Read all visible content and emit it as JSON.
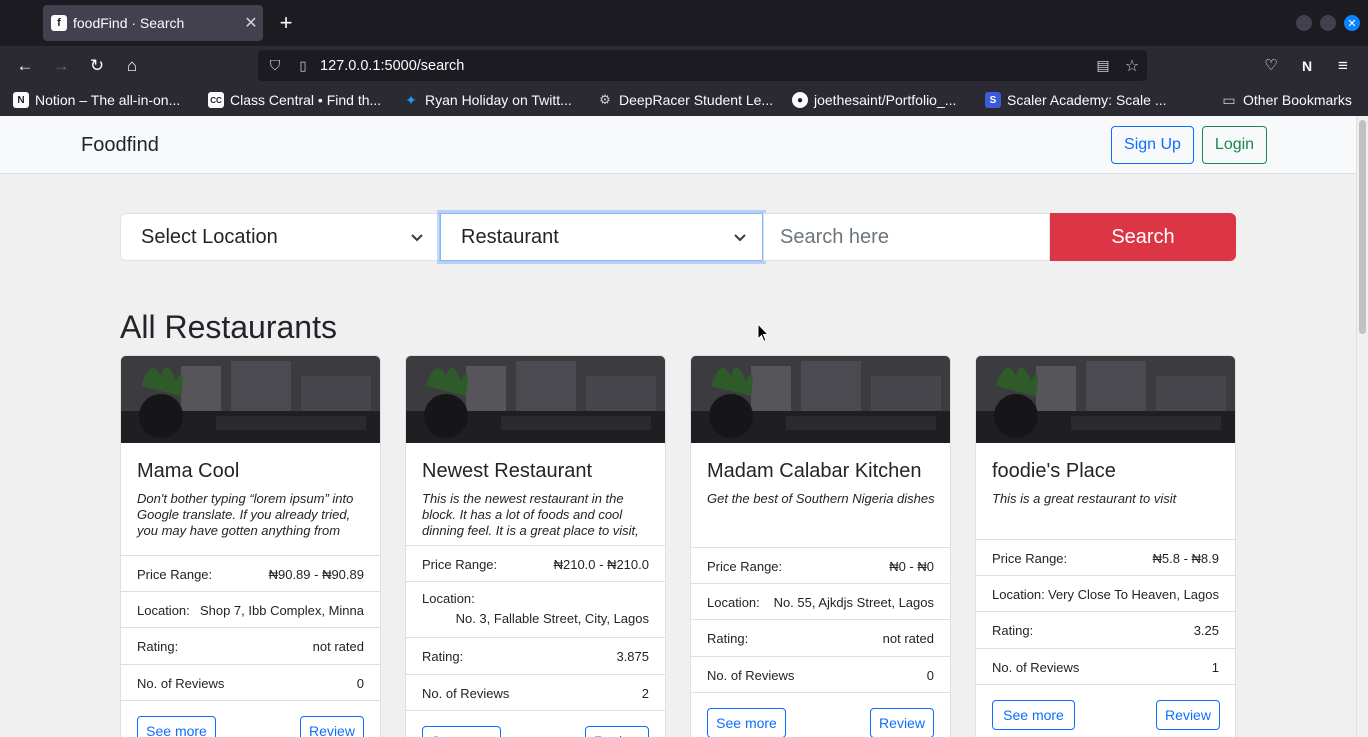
{
  "browser": {
    "tab_title": "foodFind · Search",
    "favicon_letter": "f",
    "url": "127.0.0.1:5000/search",
    "bookmarks": [
      "Notion – The all-in-on...",
      "Class Central • Find th...",
      "Ryan Holiday on Twitt...",
      "DeepRacer Student Le...",
      "joethesaint/Portfolio_...",
      "Scaler Academy: Scale ..."
    ],
    "other_bookmarks": "Other Bookmarks"
  },
  "header": {
    "brand": "Foodfind",
    "signup_label": "Sign Up",
    "login_label": "Login"
  },
  "search": {
    "location_selected": "Select Location",
    "category_selected": "Restaurant",
    "placeholder": "Search here",
    "button_label": "Search"
  },
  "section_title": "All Restaurants",
  "labels": {
    "price_range": "Price Range:",
    "location": "Location:",
    "rating": "Rating:",
    "reviews": "No. of Reviews",
    "see_more": "See more",
    "review": "Review"
  },
  "restaurants": [
    {
      "name": "Mama Cool",
      "description": "Don't bother typing “lorem ipsum” into Google translate. If you already tried, you may have gotten anything from",
      "price_range": "₦90.89 - ₦90.89",
      "location": "Shop 7, Ibb Complex, Minna",
      "rating": "not rated",
      "reviews": "0"
    },
    {
      "name": "Newest Restaurant",
      "description": "This is the newest restaurant in the block. It has a lot of foods and cool dinning feel. It is a great place to visit,",
      "price_range": "₦210.0 - ₦210.0",
      "location": "No. 3, Fallable Street, City, Lagos",
      "rating": "3.875",
      "reviews": "2"
    },
    {
      "name": "Madam Calabar Kitchen",
      "description": "Get the best of Southern Nigeria dishes",
      "price_range": "₦0 - ₦0",
      "location": "No. 55, Ajkdjs Street, Lagos",
      "rating": "not rated",
      "reviews": "0"
    },
    {
      "name": "foodie's Place",
      "description": "This is a great restaurant to visit",
      "price_range": "₦5.8 - ₦8.9",
      "location": "Very Close To Heaven, Lagos",
      "rating": "3.25",
      "reviews": "1"
    }
  ],
  "colors": {
    "primary": "#0d6efd",
    "success": "#198754",
    "danger": "#dc3545"
  }
}
